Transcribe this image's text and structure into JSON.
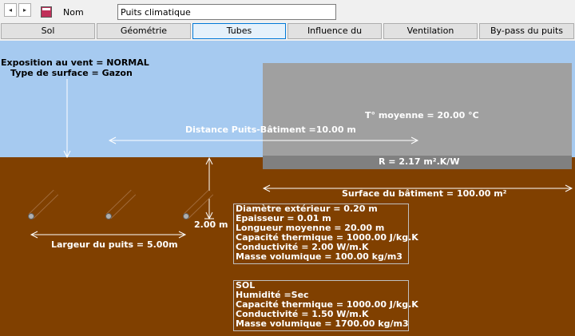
{
  "toolbar": {
    "nav_prev_glyph": "◂",
    "nav_next_glyph": "▸",
    "app_icon": "document-icon",
    "nom_label": "Nom",
    "nom_value": "Puits climatique"
  },
  "tabs": [
    {
      "label": "Sol",
      "active": false
    },
    {
      "label": "Géométrie",
      "active": false
    },
    {
      "label": "Tubes",
      "active": true
    },
    {
      "label": "Influence du bâtiment",
      "active": false
    },
    {
      "label": "Ventilation",
      "active": false
    },
    {
      "label": "By-pass du puits",
      "active": false
    }
  ],
  "scene": {
    "exposition": "Exposition au vent = NORMAL",
    "surface_type": "Type de surface = Gazon",
    "distance": "Distance Puits-Bâtiment =10.00 m",
    "temperature": "T° moyenne = 20.00 °C",
    "resistance": "R = 2.17 m².K/W",
    "building_surface": "Surface du bâtiment = 100.00 m²",
    "depth": "2.00 m",
    "width": "Largeur du puits = 5.00m",
    "pipe": [
      "Diamètre extérieur = 0.20 m",
      "Epaisseur = 0.01 m",
      "Longueur moyenne = 20.00 m",
      "Capacité thermique = 1000.00 J/kg.K",
      "Conductivité = 2.00 W/m.K",
      "Masse volumique = 100.00 kg/m3"
    ],
    "soil": [
      "SOL",
      "Humidité =Sec",
      "Capacité thermique = 1000.00 J/kg.K",
      "Conductivité = 1.50 W/m.K",
      "Masse volumique = 1700.00 kg/m3"
    ],
    "colors": {
      "sky": "#a6caf0",
      "ground": "#804000",
      "building": "#a0a0a0",
      "slab": "#808080"
    }
  }
}
